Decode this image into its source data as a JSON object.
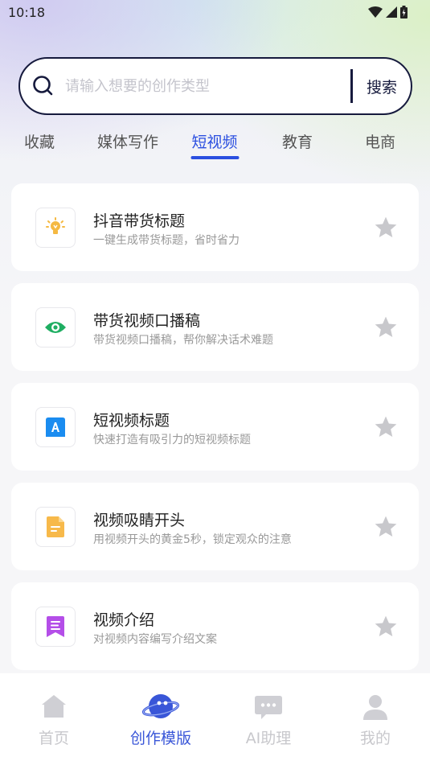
{
  "status_bar": {
    "time": "10:18"
  },
  "search": {
    "placeholder": "请输入想要的创作类型",
    "button_label": "搜索"
  },
  "tabs": [
    {
      "label": "收藏",
      "active": false
    },
    {
      "label": "媒体写作",
      "active": false
    },
    {
      "label": "短视频",
      "active": true
    },
    {
      "label": "教育",
      "active": false
    },
    {
      "label": "电商",
      "active": false
    }
  ],
  "cards": [
    {
      "title": "抖音带货标题",
      "desc": "一键生成带货标题，省时省力",
      "icon": "lightbulb-icon",
      "icon_color": "#f5b942"
    },
    {
      "title": "带货视频口播稿",
      "desc": "带货视频口播稿，帮你解决话术难题",
      "icon": "eye-icon",
      "icon_color": "#1fae62"
    },
    {
      "title": "短视频标题",
      "desc": "快速打造有吸引力的短视频标题",
      "icon": "text-a-icon",
      "icon_color": "#1a8cf0"
    },
    {
      "title": "视频吸睛开头",
      "desc": "用视频开头的黄金5秒，锁定观众的注意",
      "icon": "document-icon",
      "icon_color": "#f7b94a"
    },
    {
      "title": "视频介绍",
      "desc": "对视频内容编写介绍文案",
      "icon": "bookmark-list-icon",
      "icon_color": "#b44ee8"
    }
  ],
  "bottom_nav": [
    {
      "label": "首页",
      "icon": "home-icon",
      "active": false
    },
    {
      "label": "创作模版",
      "icon": "planet-icon",
      "active": true
    },
    {
      "label": "AI助理",
      "icon": "chat-icon",
      "active": false
    },
    {
      "label": "我的",
      "icon": "person-icon",
      "active": false
    }
  ],
  "colors": {
    "accent": "#2a4ee0",
    "search_border": "#161a3d",
    "star": "#c8c8cc"
  }
}
